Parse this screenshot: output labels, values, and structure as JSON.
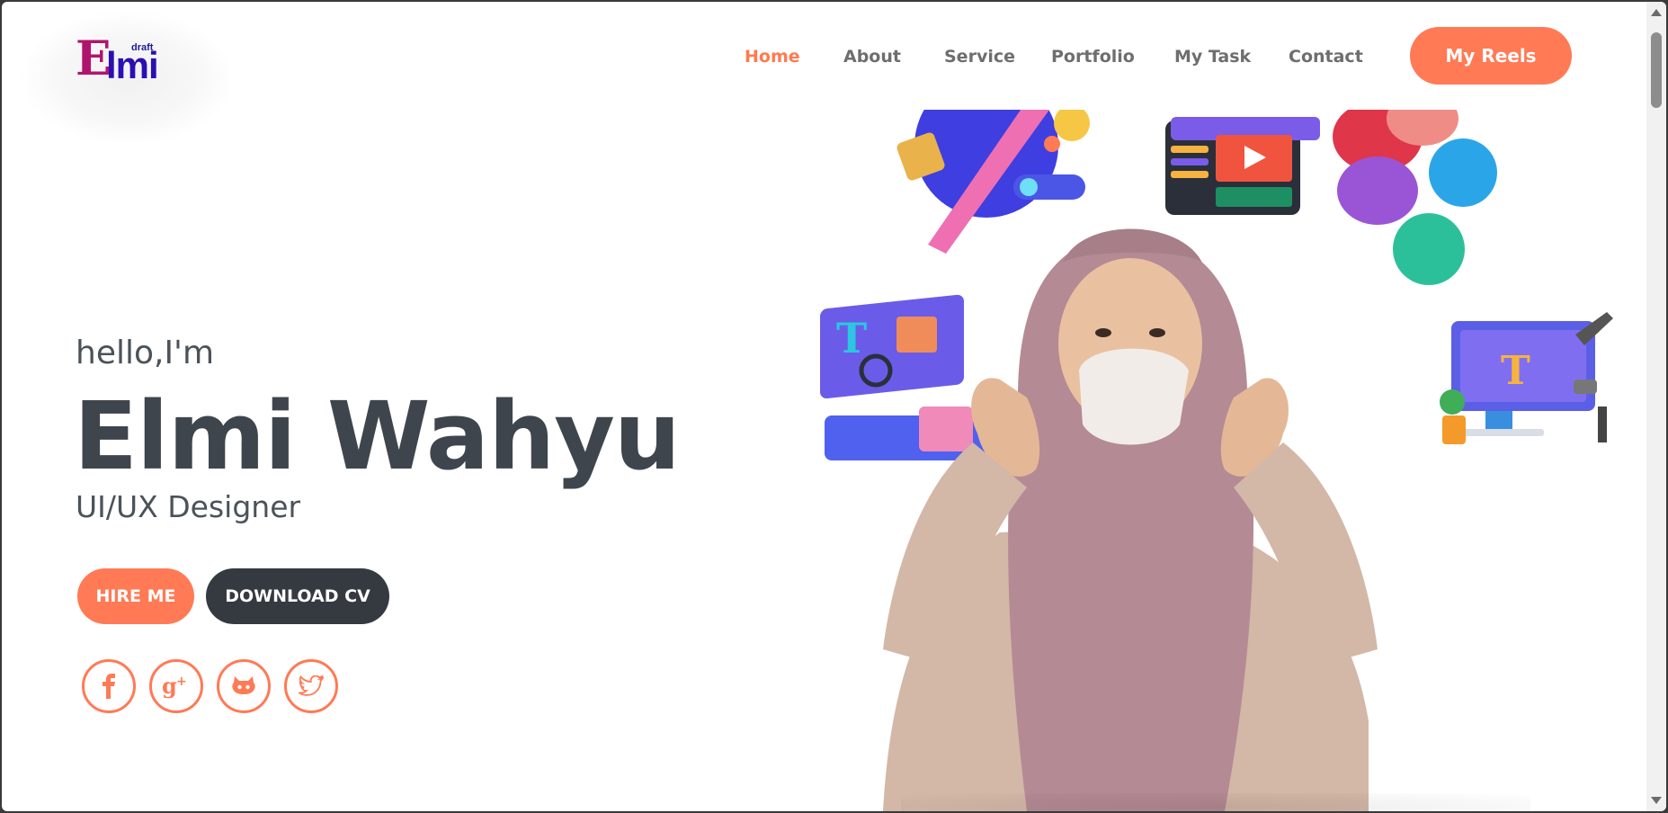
{
  "logo": {
    "letter_e": "E",
    "letters_mi": "lmi",
    "tag": "draft"
  },
  "nav": {
    "items": [
      {
        "label": "Home",
        "active": true
      },
      {
        "label": "About",
        "active": false
      },
      {
        "label": "Service",
        "active": false
      },
      {
        "label": "Portfolio",
        "active": false
      },
      {
        "label": "My Task",
        "active": false
      },
      {
        "label": "Contact",
        "active": false
      }
    ],
    "cta_label": "My Reels"
  },
  "hero": {
    "greeting": "hello,I'm",
    "name": "Elmi Wahyu",
    "role": "UI/UX Designer",
    "hire_label": "HIRE ME",
    "cv_label": "DOWNLOAD CV"
  },
  "social": [
    {
      "icon": "facebook-icon"
    },
    {
      "icon": "google-plus-icon"
    },
    {
      "icon": "github-icon"
    },
    {
      "icon": "twitter-icon"
    }
  ],
  "colors": {
    "accent": "#ff7a55",
    "dark_button": "#343a40",
    "text": "#3f454c",
    "logo_e": "#b0156d",
    "logo_mi": "#2c0fb3"
  }
}
